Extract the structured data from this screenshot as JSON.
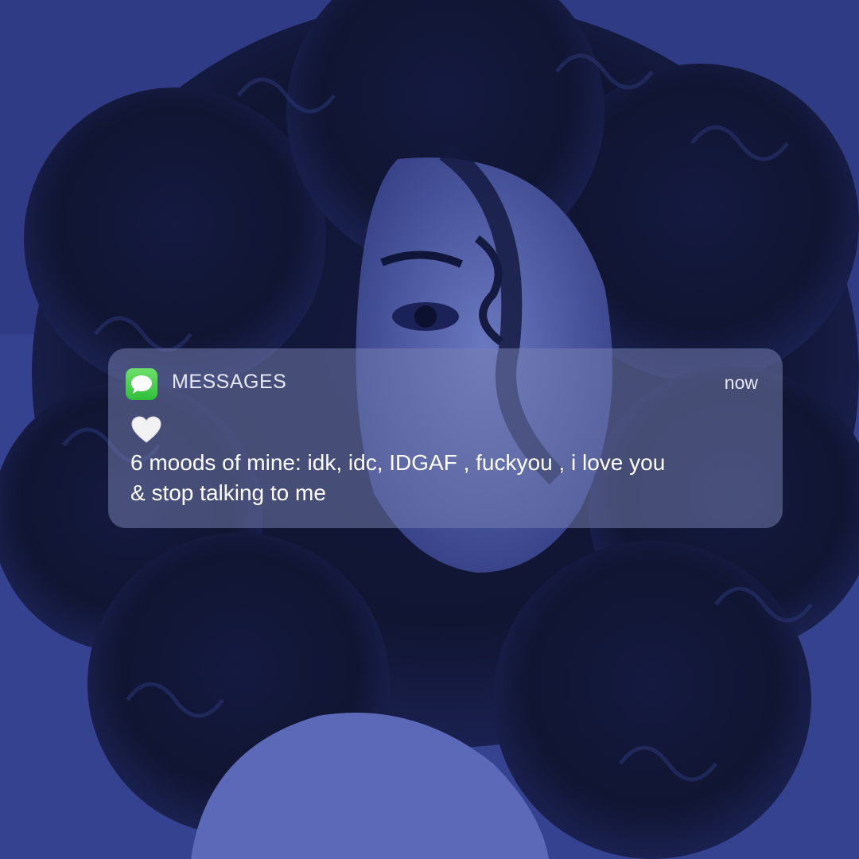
{
  "notification": {
    "app_icon": "messages-icon",
    "app_name": "MESSAGES",
    "time": "now",
    "emoji_icon": "white-heart-icon",
    "message_lines": [
      "6 moods of mine: idk, idc, IDGAF , fuckyou , i love you",
      "& stop talking to me"
    ]
  },
  "colors": {
    "background_tint": "#2e3a7a",
    "notification_bg": "#7680b2",
    "messages_green": "#3ccb45",
    "text": "#ffffff"
  }
}
